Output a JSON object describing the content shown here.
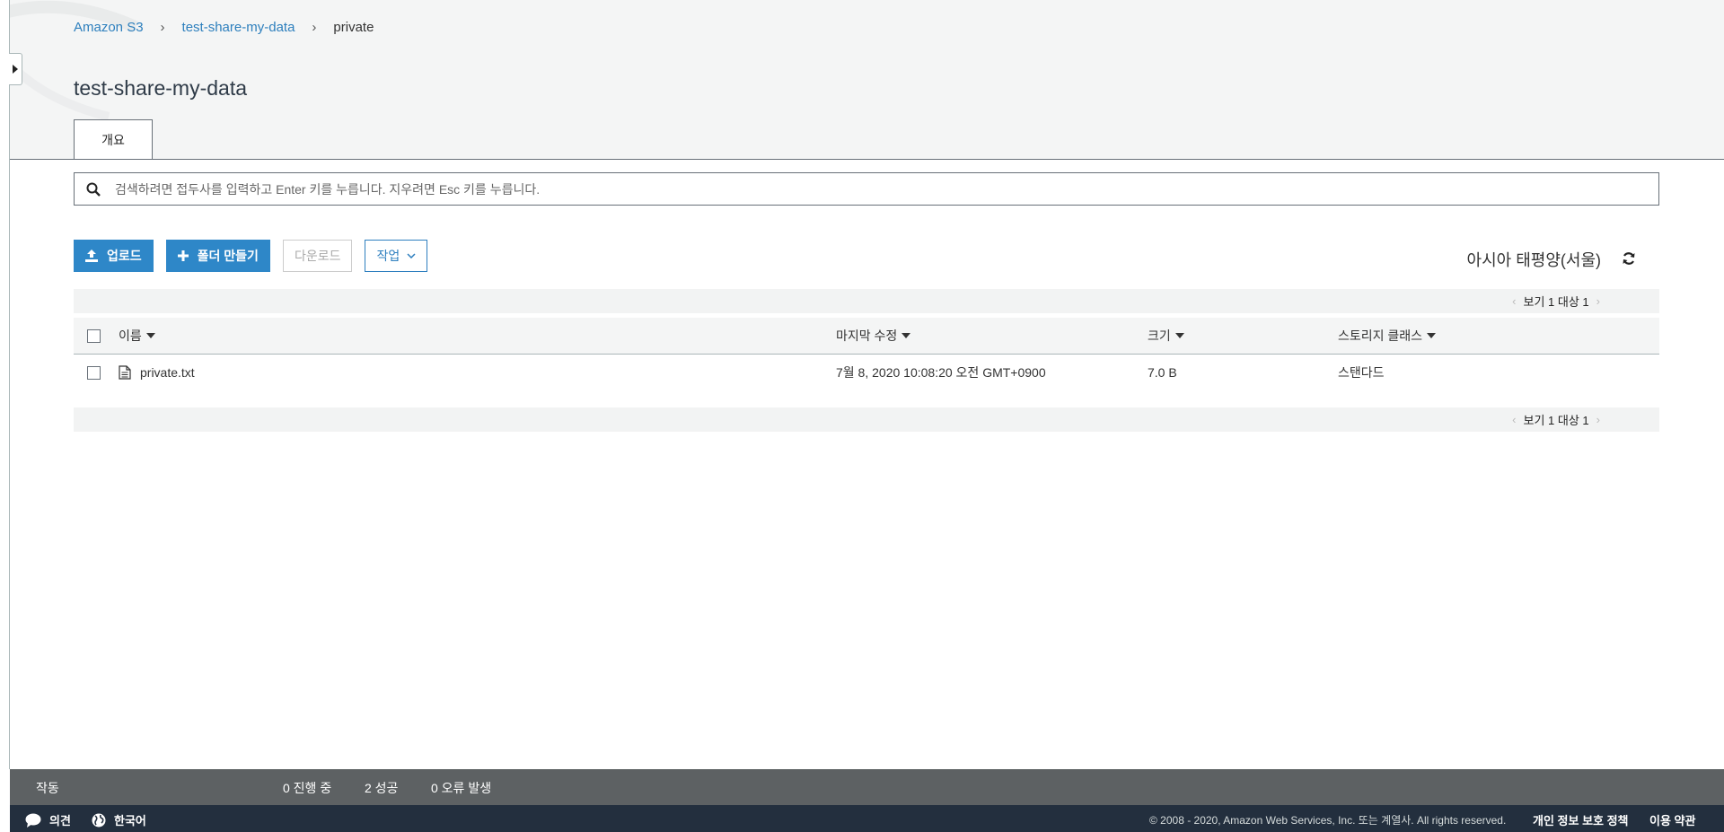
{
  "breadcrumb": {
    "items": [
      "Amazon S3",
      "test-share-my-data"
    ],
    "current": "private",
    "separator": "›"
  },
  "page": {
    "title": "test-share-my-data",
    "tab_overview": "개요"
  },
  "search": {
    "placeholder": "검색하려면 접두사를 입력하고 Enter 키를 누릅니다. 지우려면 Esc 키를 누릅니다."
  },
  "toolbar": {
    "upload_label": "업로드",
    "create_folder_label": "폴더 만들기",
    "download_label": "다운로드",
    "actions_label": "작업"
  },
  "region": "아시아 태평양(서울)",
  "pager": {
    "text": "보기 1 대상 1"
  },
  "table": {
    "columns": {
      "name": "이름",
      "last_modified": "마지막 수정",
      "size": "크기",
      "storage_class": "스토리지 클래스"
    },
    "rows": [
      {
        "name": "private.txt",
        "last_modified": "7월 8, 2020 10:08:20 오전 GMT+0900",
        "size": "7.0 B",
        "storage_class": "스탠다드"
      }
    ]
  },
  "status_bar": {
    "label": "작동",
    "in_progress": "0 진행 중",
    "success": "2 성공",
    "errors": "0 오류 발생"
  },
  "footer": {
    "feedback": "의견",
    "language": "한국어",
    "copyright": "© 2008 - 2020, Amazon Web Services, Inc. 또는 계열사. All rights reserved.",
    "privacy": "개인 정보 보호 정책",
    "terms": "이용 약관"
  },
  "colors": {
    "accent": "#2e87c8",
    "link": "#2d7fbd",
    "status_bar": "#5d6163",
    "footer": "#232f3e"
  },
  "icons": [
    "caret-right-icon",
    "search-icon",
    "upload-icon",
    "plus-icon",
    "chevron-down-icon",
    "refresh-icon",
    "file-icon",
    "speech-bubble-icon",
    "globe-icon"
  ]
}
